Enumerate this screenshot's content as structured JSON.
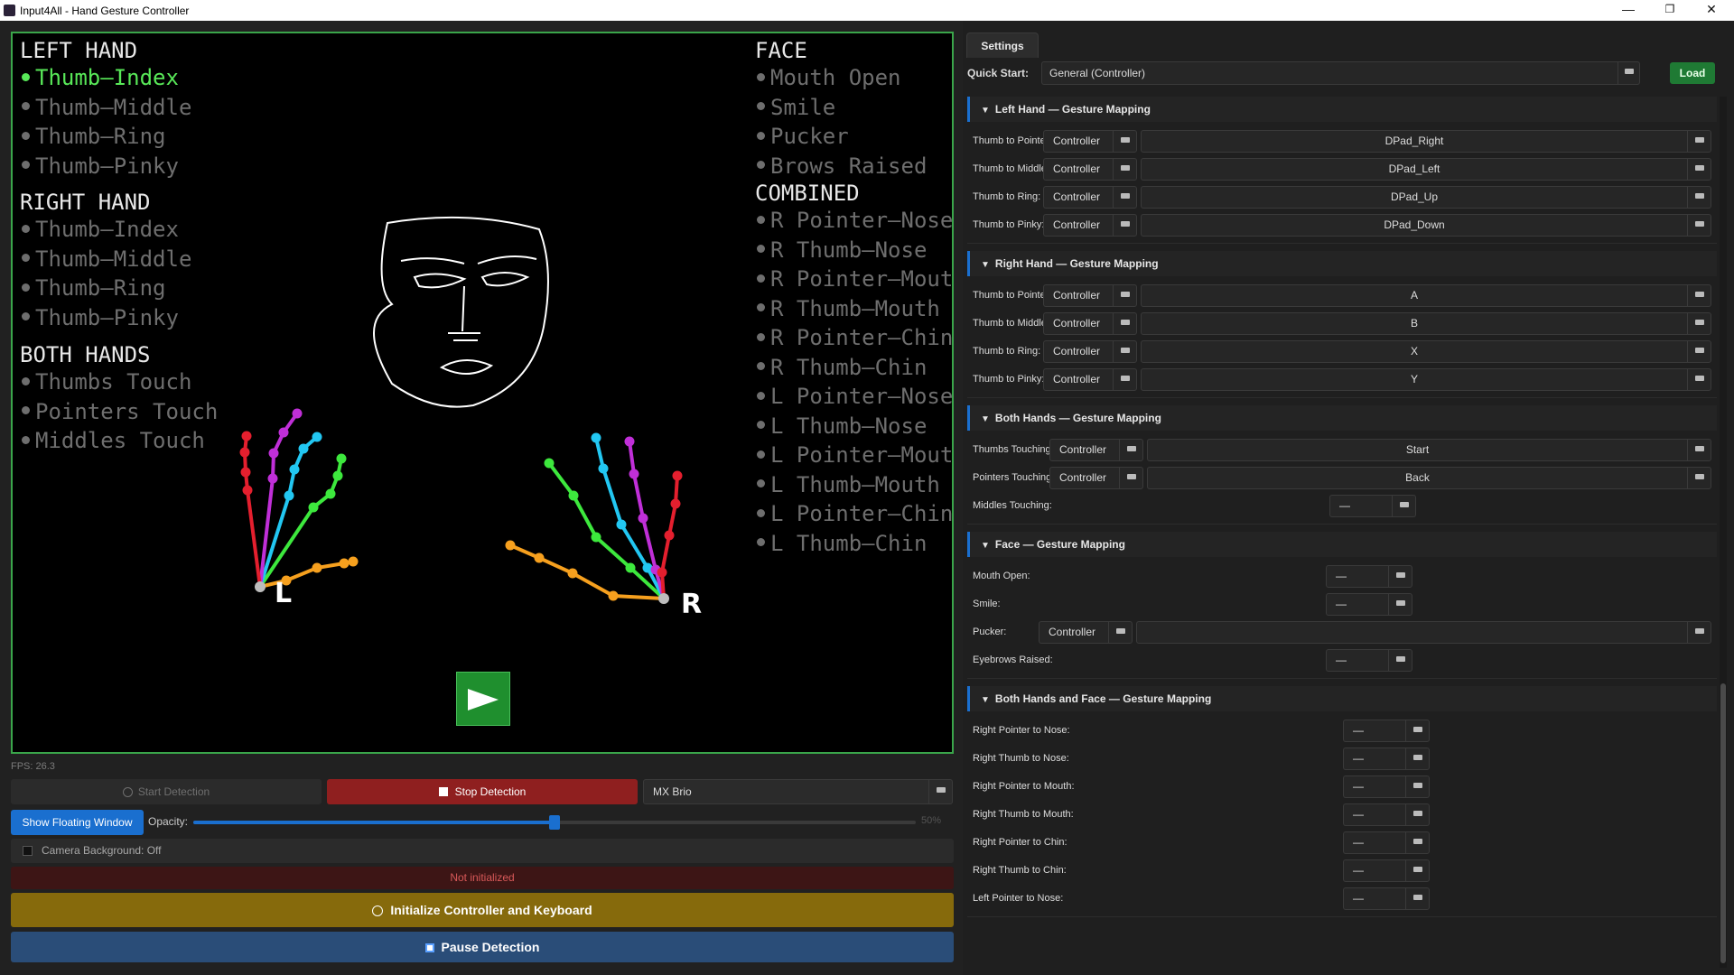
{
  "window": {
    "title": "Input4All - Hand Gesture Controller"
  },
  "preview": {
    "left_hand": {
      "title": "LEFT HAND",
      "items": [
        "Thumb–Index",
        "Thumb–Middle",
        "Thumb–Ring",
        "Thumb–Pinky"
      ],
      "active": 0
    },
    "right_hand": {
      "title": "RIGHT HAND",
      "items": [
        "Thumb–Index",
        "Thumb–Middle",
        "Thumb–Ring",
        "Thumb–Pinky"
      ]
    },
    "both_hands": {
      "title": "BOTH HANDS",
      "items": [
        "Thumbs Touch",
        "Pointers Touch",
        "Middles Touch"
      ]
    },
    "face": {
      "title": "FACE",
      "items": [
        "Mouth Open",
        "Smile",
        "Pucker",
        "Brows Raised"
      ]
    },
    "combined": {
      "title": "COMBINED",
      "items": [
        "R Pointer–Nose",
        "R Thumb–Nose",
        "R Pointer–Mouth",
        "R Thumb–Mouth",
        "R Pointer–Chin",
        "R Thumb–Chin",
        "L Pointer–Nose",
        "L Thumb–Nose",
        "L Pointer–Mouth",
        "L Thumb–Mouth",
        "L Pointer–Chin",
        "L Thumb–Chin"
      ]
    },
    "hand_labels": {
      "left": "L",
      "right": "R"
    }
  },
  "controls": {
    "fps": "FPS: 26.3",
    "start_detection": "Start Detection",
    "stop_detection": "Stop Detection",
    "camera": "MX Brio",
    "show_floating": "Show Floating Window",
    "opacity_label": "Opacity:",
    "opacity_value": "50%",
    "opacity_fraction": 0.5,
    "camera_background": "Camera Background: Off",
    "status": "Not initialized",
    "initialize": "Initialize Controller and Keyboard",
    "pause": "Pause Detection"
  },
  "settings": {
    "tab": "Settings",
    "quick_start_label": "Quick Start:",
    "quick_start_value": "General (Controller)",
    "load": "Load",
    "none_symbol": "—",
    "sections": [
      {
        "title": "Left Hand — Gesture Mapping",
        "rows": [
          {
            "label": "Thumb to Pointer:",
            "device": "Controller",
            "value": "DPad_Right"
          },
          {
            "label": "Thumb to Middle:",
            "device": "Controller",
            "value": "DPad_Left"
          },
          {
            "label": "Thumb to Ring:",
            "device": "Controller",
            "value": "DPad_Up"
          },
          {
            "label": "Thumb to Pinky:",
            "device": "Controller",
            "value": "DPad_Down"
          }
        ]
      },
      {
        "title": "Right Hand — Gesture Mapping",
        "rows": [
          {
            "label": "Thumb to Pointer:",
            "device": "Controller",
            "value": "A"
          },
          {
            "label": "Thumb to Middle:",
            "device": "Controller",
            "value": "B"
          },
          {
            "label": "Thumb to Ring:",
            "device": "Controller",
            "value": "X"
          },
          {
            "label": "Thumb to Pinky:",
            "device": "Controller",
            "value": "Y"
          }
        ]
      },
      {
        "title": "Both Hands — Gesture Mapping",
        "rows": [
          {
            "label": "Thumbs Touching:",
            "device": "Controller",
            "value": "Start"
          },
          {
            "label": "Pointers Touching:",
            "device": "Controller",
            "value": "Back"
          },
          {
            "label": "Middles Touching:",
            "device": "—",
            "value": null
          }
        ]
      },
      {
        "title": "Face — Gesture Mapping",
        "rows": [
          {
            "label": "Mouth Open:",
            "device": "—",
            "value": null
          },
          {
            "label": "Smile:",
            "device": "—",
            "value": null
          },
          {
            "label": "Pucker:",
            "device": "Controller",
            "value": ""
          },
          {
            "label": "Eyebrows Raised:",
            "device": "—",
            "value": null
          }
        ]
      },
      {
        "title": "Both Hands and Face — Gesture Mapping",
        "rows": [
          {
            "label": "Right Pointer to Nose:",
            "device": "—",
            "value": null
          },
          {
            "label": "Right Thumb to Nose:",
            "device": "—",
            "value": null
          },
          {
            "label": "Right Pointer to Mouth:",
            "device": "—",
            "value": null
          },
          {
            "label": "Right Thumb to Mouth:",
            "device": "—",
            "value": null
          },
          {
            "label": "Right Pointer to Chin:",
            "device": "—",
            "value": null
          },
          {
            "label": "Right Thumb to Chin:",
            "device": "—",
            "value": null
          },
          {
            "label": "Left Pointer to Nose:",
            "device": "—",
            "value": null
          }
        ]
      }
    ]
  },
  "colors": {
    "accent": "#1a6fcf",
    "active_gesture": "#58e858",
    "stop": "#8f1f1f",
    "init": "#866a0c",
    "pause": "#2a4d78",
    "load": "#1f7a34"
  }
}
